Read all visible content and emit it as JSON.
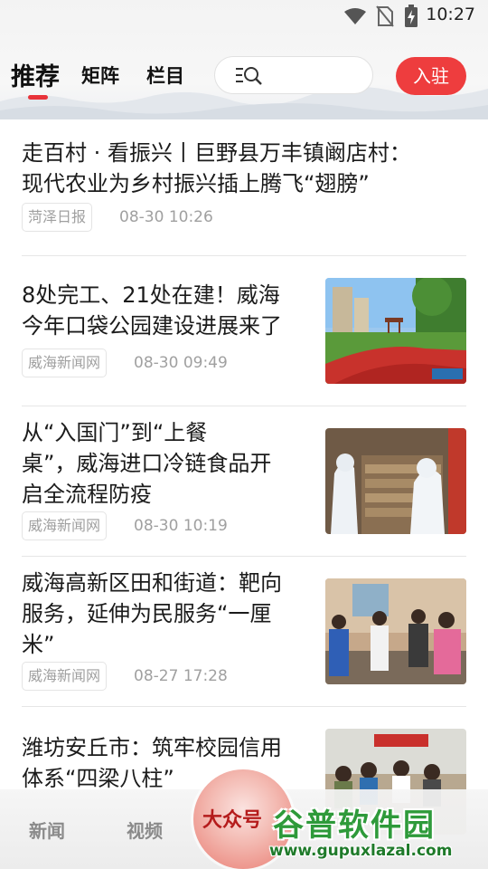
{
  "status_bar": {
    "time": "10:27"
  },
  "nav": {
    "tabs": [
      {
        "label": "推荐"
      },
      {
        "label": "矩阵"
      },
      {
        "label": "栏目"
      }
    ],
    "join_label": "入驻"
  },
  "news": [
    {
      "title_lines": [
        "走百村 · 看振兴丨巨野县万丰镇阚店村：",
        "现代农业为乡村振兴插上腾飞“翅膀”"
      ],
      "source": "菏泽日报",
      "time": "08-30 10:26"
    },
    {
      "title_lines": [
        "8处完工、21处在建！威海",
        "今年口袋公园建设进展来了"
      ],
      "source": "威海新闻网",
      "time": "08-30 09:49"
    },
    {
      "title_lines": [
        "从“入国门”到“上餐",
        "桌”，威海进口冷链食品开",
        "启全流程防疫"
      ],
      "source": "威海新闻网",
      "time": "08-30 10:19"
    },
    {
      "title_lines": [
        "威海高新区田和街道：靶向",
        "服务，延伸为民服务“一厘",
        "米”"
      ],
      "source": "威海新闻网",
      "time": "08-27 17:28"
    },
    {
      "title_lines": [
        "潍坊安丘市：筑牢校园信用",
        "体系“四梁八柱”"
      ]
    }
  ],
  "bottom_nav": {
    "tabs": [
      {
        "label": "新闻"
      },
      {
        "label": "视频"
      }
    ],
    "center_label": "大众号"
  },
  "watermark": {
    "title": "谷普软件园",
    "url": "www.gupuxlazal.com"
  },
  "colors": {
    "accent": "#ee3d3e",
    "meta_text": "#a0a0a0"
  }
}
